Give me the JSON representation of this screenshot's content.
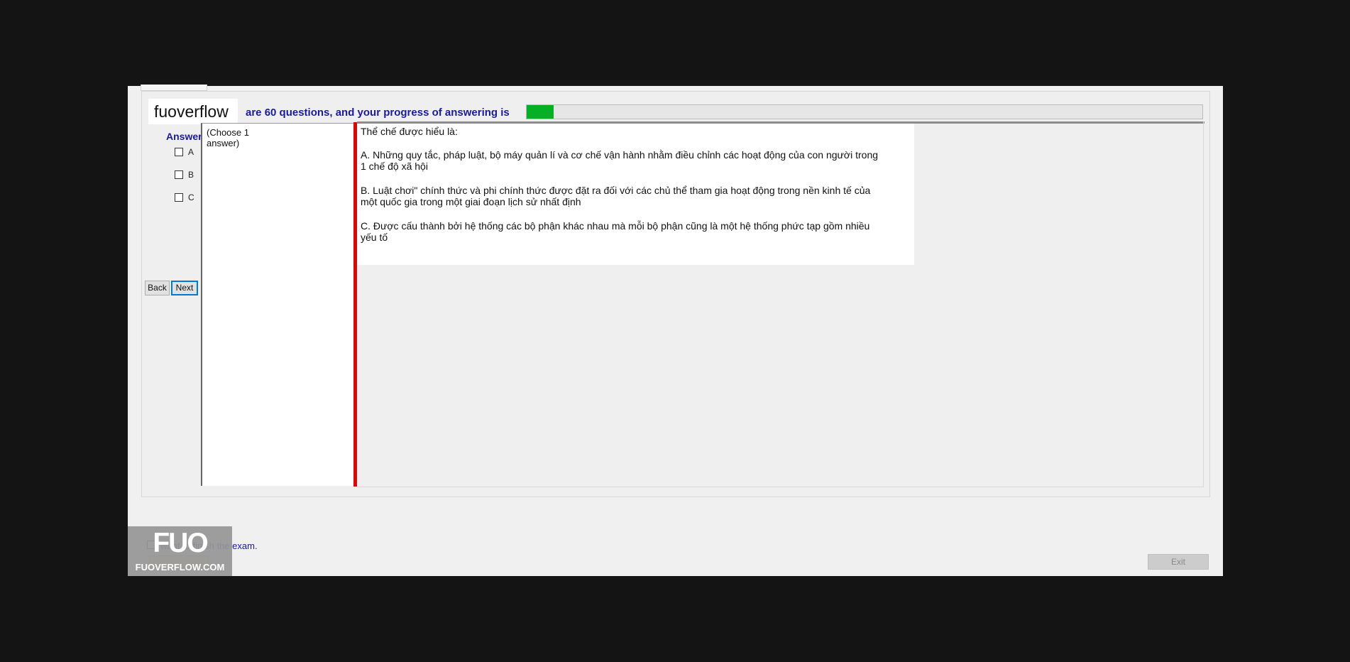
{
  "header": {
    "brand": "fuoverflow",
    "progress_text": "are 60 questions, and your progress of answering is",
    "progress_fraction": 0.04
  },
  "answer_panel": {
    "heading": "Answer",
    "options": [
      "A",
      "B",
      "C"
    ]
  },
  "navigation": {
    "back_label": "Back",
    "next_label": "Next"
  },
  "choose_note": "(Choose 1 answer)",
  "question": {
    "stem": "Thể chế được hiểu là:",
    "options": [
      "A.  Những quy tắc, pháp luật, bộ máy quản lí và cơ chế vận hành nhằm điều chỉnh các hoạt động của con người trong 1 chế độ xã hội",
      "B.  Luật chơi\" chính thức và phi chính thức được đặt ra đối với các chủ thể tham gia hoạt động trong nền kinh tế của một quốc gia trong một giai đoạn lịch sử nhất định",
      "C.  Được cấu thành bởi hệ thống các bộ phận khác nhau mà mỗi bộ phận cũng là một hệ thống phức tạp gồm nhiều yếu tố"
    ]
  },
  "footer": {
    "finish_label": "want to finish the exam.",
    "exit_label": "Exit"
  },
  "watermark": {
    "logo": "FUO",
    "site": "FUOVERFLOW.COM"
  },
  "colors": {
    "accent_text": "#1b1b9a",
    "progress_fill": "#06b025",
    "divider_red": "#d20a0a"
  }
}
